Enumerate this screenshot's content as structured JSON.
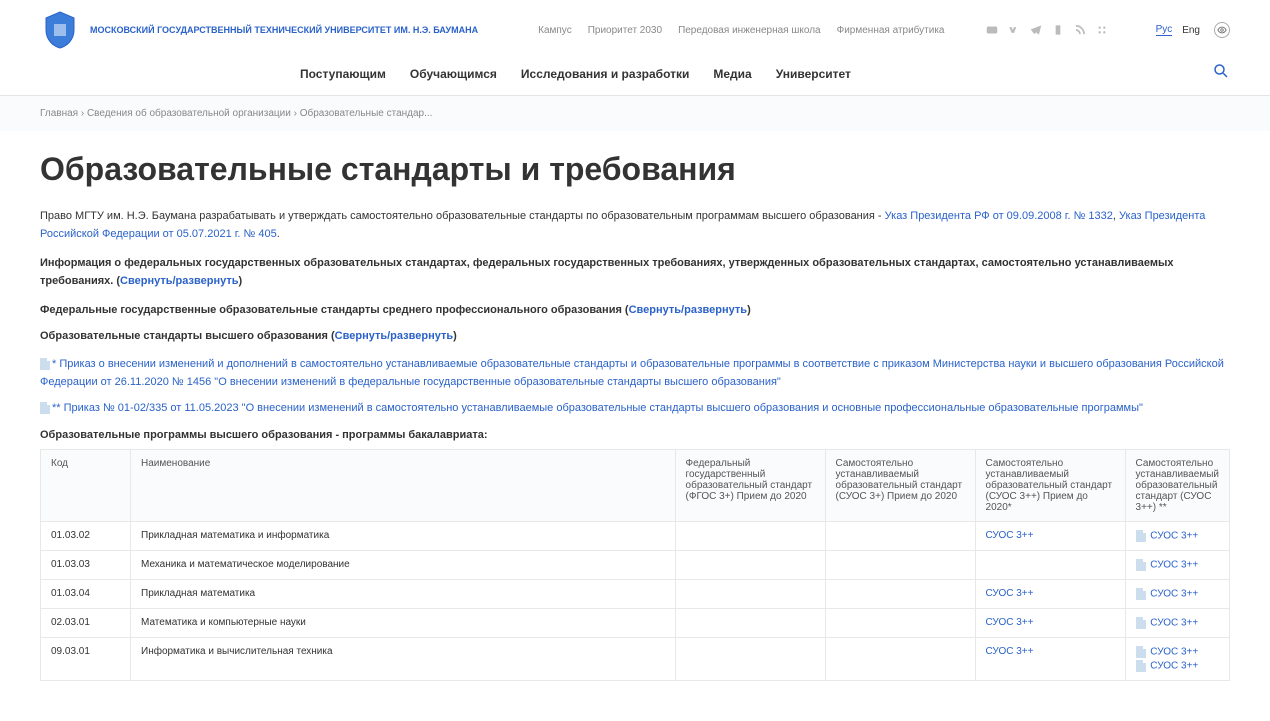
{
  "header": {
    "uni_name": "МОСКОВСКИЙ ГОСУДАРСТВЕННЫЙ ТЕХНИЧЕСКИЙ УНИВЕРСИТЕТ ИМ. Н.Э. БАУМАНА",
    "top_nav": [
      "Кампус",
      "Приоритет 2030",
      "Передовая инженерная школа",
      "Фирменная атрибутика"
    ],
    "lang_ru": "Рус",
    "lang_en": "Eng",
    "main_nav": [
      "Поступающим",
      "Обучающимся",
      "Исследования и разработки",
      "Медиа",
      "Университет"
    ]
  },
  "breadcrumbs": [
    "Главная",
    "Сведения об образовательной организации",
    "Образовательные стандар..."
  ],
  "title": "Образовательные стандарты и требования",
  "intro": {
    "text1": "Право МГТУ им. Н.Э. Баумана разрабатывать и утверждать самостоятельно образовательные стандарты по образовательным программам высшего образования - ",
    "link1": "Указ Президента РФ от 09.09.2008 г. № 1332",
    "sep": ", ",
    "link2": "Указ Президента Российской Федерации от 05.07.2021 г. № 405",
    "dot": "."
  },
  "para2": {
    "text": "Информация о федеральных государственных образовательных стандартах, федеральных государственных требованиях, утвержденных образовательных стандартах, самостоятельно устанавливаемых требованиях. (",
    "link": "Свернуть/развернуть",
    "close": ")"
  },
  "para3": {
    "text": "Федеральные государственные образовательные стандарты среднего профессионального образования (",
    "link": "Свернуть/развернуть",
    "close": ")"
  },
  "para4": {
    "text": "Образовательные стандарты высшего образования (",
    "link": "Свернуть/развернуть",
    "close": ")"
  },
  "note1": {
    "prefix": "* ",
    "link": "Приказ о внесении изменений и дополнений в самостоятельно устанавливаемые образовательные стандарты и образовательные программы в соответствие с приказом Министерства науки и высшего образования Российской Федерации от 26.11.2020 № 1456 \"О внесении изменений в федеральные государственные образовательные стандарты высшего образования\""
  },
  "note2": {
    "prefix": "** ",
    "link": "Приказ № 01-02/335 от 11.05.2023 \"О внесении изменений в самостоятельно устанавливаемые образовательные стандарты высшего образования и основные профессиональные образовательные программы\""
  },
  "subtitle": "Образовательные программы высшего образования - программы бакалавриата:",
  "table": {
    "headers": [
      "Код",
      "Наименование",
      "Федеральный государственный образовательный стандарт (ФГОС 3+) Прием до 2020",
      "Самостоятельно устанавливаемый образовательный стандарт (СУОС 3+) Прием до 2020",
      "Самостоятельно устанавливаемый образовательный стандарт (СУОС 3++) Прием до 2020*",
      "Самостоятельно устанавливаемый образовательный стандарт (СУОС 3++) **"
    ],
    "rows": [
      {
        "code": "01.03.02",
        "name": "Прикладная математика и информатика",
        "c3": "",
        "c4": "",
        "c5": "СУОС 3++",
        "c6": [
          "СУОС 3++"
        ]
      },
      {
        "code": "01.03.03",
        "name": "Механика и математическое моделирование",
        "c3": "",
        "c4": "",
        "c5": "",
        "c6": [
          "СУОС 3++"
        ]
      },
      {
        "code": "01.03.04",
        "name": "Прикладная математика",
        "c3": "",
        "c4": "",
        "c5": "СУОС 3++",
        "c6": [
          "СУОС 3++"
        ]
      },
      {
        "code": "02.03.01",
        "name": "Математика и компьютерные науки",
        "c3": "",
        "c4": "",
        "c5": "СУОС 3++",
        "c6": [
          "СУОС 3++"
        ]
      },
      {
        "code": "09.03.01",
        "name": "Информатика и вычислительная техника",
        "c3": "",
        "c4": "",
        "c5": "СУОС 3++",
        "c6": [
          "СУОС 3++",
          "СУОС 3++"
        ]
      }
    ]
  }
}
